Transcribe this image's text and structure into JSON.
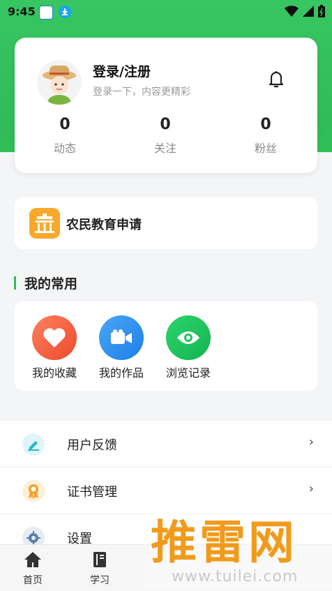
{
  "status_bar": {
    "time": "9:45"
  },
  "profile": {
    "login_label": "登录/注册",
    "subtitle": "登录一下，内容更精彩",
    "stats": [
      {
        "value": "0",
        "label": "动态"
      },
      {
        "value": "0",
        "label": "关注"
      },
      {
        "value": "0",
        "label": "粉丝"
      }
    ]
  },
  "education": {
    "label": "农民教育申请",
    "icon": "school-building-icon"
  },
  "common": {
    "title": "我的常用",
    "items": [
      {
        "label": "我的收藏",
        "icon": "heart-icon",
        "color": "#f0613b"
      },
      {
        "label": "我的作品",
        "icon": "video-camera-icon",
        "color": "#2c8ff0"
      },
      {
        "label": "浏览记录",
        "icon": "eye-icon",
        "color": "#1fc561"
      }
    ]
  },
  "menu": [
    {
      "label": "用户反馈",
      "icon": "pencil-icon",
      "arrow": "›"
    },
    {
      "label": "证书管理",
      "icon": "certificate-icon",
      "arrow": "›"
    },
    {
      "label": "设置",
      "icon": "gear-icon"
    }
  ],
  "tabbar": [
    {
      "label": "首页",
      "icon": "home-icon"
    },
    {
      "label": "学习",
      "icon": "book-icon"
    }
  ],
  "watermark": {
    "title": "推雷网",
    "url": "www.tuilei.com"
  },
  "colors": {
    "brand_green": "#2fbe57",
    "accent_orange": "#f8a92c"
  }
}
